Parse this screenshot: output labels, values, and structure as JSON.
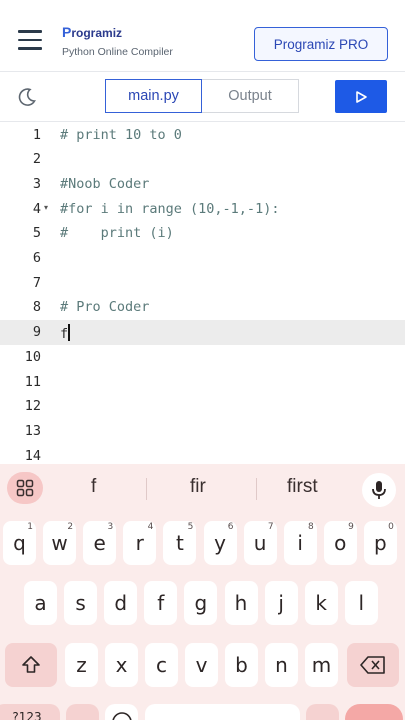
{
  "header": {
    "logo_text": "rogramiz",
    "logo_initial": "P",
    "subtitle": "Python Online Compiler",
    "pro_button": "Programiz PRO"
  },
  "tabs": {
    "main_label": "main.py",
    "output_label": "Output"
  },
  "editor": {
    "lines": [
      {
        "num": "1",
        "text": "# print 10 to 0",
        "fold": ""
      },
      {
        "num": "2",
        "text": "",
        "fold": ""
      },
      {
        "num": "3",
        "text": "#Noob Coder",
        "fold": ""
      },
      {
        "num": "4",
        "text": "#for i in range (10,-1,-1):",
        "fold": "▾"
      },
      {
        "num": "5",
        "text": "#    print (i)",
        "fold": ""
      },
      {
        "num": "6",
        "text": "",
        "fold": ""
      },
      {
        "num": "7",
        "text": "",
        "fold": ""
      },
      {
        "num": "8",
        "text": "# Pro Coder",
        "fold": ""
      },
      {
        "num": "9",
        "text": "f",
        "fold": "",
        "active": true
      },
      {
        "num": "10",
        "text": "",
        "fold": ""
      },
      {
        "num": "11",
        "text": "",
        "fold": ""
      },
      {
        "num": "12",
        "text": "",
        "fold": ""
      },
      {
        "num": "13",
        "text": "",
        "fold": ""
      },
      {
        "num": "14",
        "text": "",
        "fold": ""
      }
    ]
  },
  "keyboard": {
    "suggestions": [
      "f",
      "fir",
      "first"
    ],
    "row1": [
      {
        "k": "q",
        "h": "1"
      },
      {
        "k": "w",
        "h": "2"
      },
      {
        "k": "e",
        "h": "3"
      },
      {
        "k": "r",
        "h": "4"
      },
      {
        "k": "t",
        "h": "5"
      },
      {
        "k": "y",
        "h": "6"
      },
      {
        "k": "u",
        "h": "7"
      },
      {
        "k": "i",
        "h": "8"
      },
      {
        "k": "o",
        "h": "9"
      },
      {
        "k": "p",
        "h": "0"
      }
    ],
    "row2": [
      "a",
      "s",
      "d",
      "f",
      "g",
      "h",
      "j",
      "k",
      "l"
    ],
    "row3": [
      "z",
      "x",
      "c",
      "v",
      "b",
      "n",
      "m"
    ],
    "bottom_left_label": "?123"
  },
  "icons": {
    "menu": "hamburger-icon",
    "theme": "moon-icon",
    "run": "play-icon",
    "apps": "grid-icon",
    "mic": "microphone-icon",
    "shift": "shift-icon",
    "backspace": "backspace-icon"
  },
  "colors": {
    "accent": "#1e5ae6",
    "keyboard_bg": "#fbeceb",
    "key_dark": "#f5d2d1"
  }
}
